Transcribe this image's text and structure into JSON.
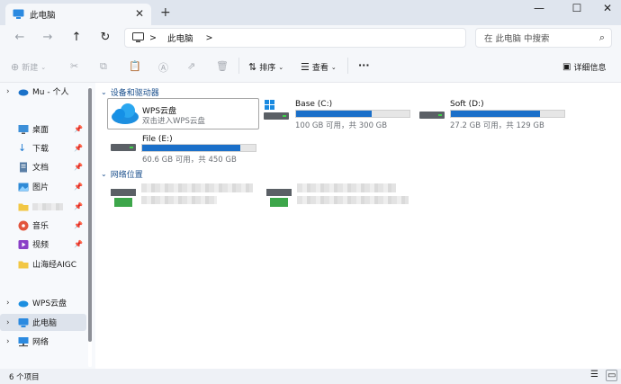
{
  "window": {
    "tab_title": "此电脑",
    "new_tab": "+",
    "close_tab": "✕",
    "minimize": "—",
    "maximize": "☐",
    "close": "✕"
  },
  "address": {
    "path_segment": "此电脑",
    "separator": ">",
    "search_placeholder": "在 此电脑 中搜索"
  },
  "toolbar": {
    "new_label": "新建",
    "sort_label": "排序",
    "view_label": "查看",
    "more_label": "···",
    "details_label": "详细信息"
  },
  "sidebar": {
    "items": [
      {
        "label": "Mu - 个人",
        "icon": "cloud-icon"
      },
      {
        "label": "桌面",
        "icon": "desktop-icon"
      },
      {
        "label": "下载",
        "icon": "download-icon"
      },
      {
        "label": "文档",
        "icon": "document-icon"
      },
      {
        "label": "图片",
        "icon": "pictures-icon"
      },
      {
        "label": "",
        "icon": "folder-icon"
      },
      {
        "label": "音乐",
        "icon": "music-icon"
      },
      {
        "label": "视频",
        "icon": "video-icon"
      },
      {
        "label": "山海经AIGC",
        "icon": "folder-icon"
      },
      {
        "label": "WPS云盘",
        "icon": "cloud-icon"
      },
      {
        "label": "此电脑",
        "icon": "computer-icon"
      },
      {
        "label": "网络",
        "icon": "network-icon"
      }
    ]
  },
  "sections": {
    "devices_title": "设备和驱动器",
    "network_title": "网络位置"
  },
  "drives": [
    {
      "name": "WPS云盘",
      "sub": "双击进入WPS云盘"
    },
    {
      "name": "Base (C:)",
      "sub": "100 GB 可用，共 300 GB",
      "used_fraction": 0.667
    },
    {
      "name": "Soft (D:)",
      "sub": "27.2 GB 可用，共 129 GB",
      "used_fraction": 0.789
    },
    {
      "name": "File (E:)",
      "sub": "60.6 GB 可用，共 450 GB",
      "used_fraction": 0.865
    }
  ],
  "status": {
    "item_count": "6 个项目"
  },
  "colors": {
    "accent": "#1a6fc9",
    "section_title": "#1a4f8c"
  }
}
